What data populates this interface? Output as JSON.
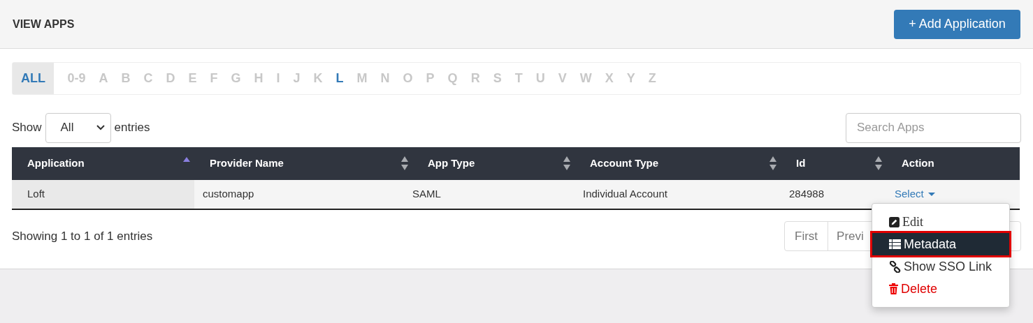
{
  "header": {
    "title": "VIEW APPS",
    "add_button": "+ Add Application"
  },
  "letters": [
    {
      "label": "ALL",
      "selected": true,
      "enabled": true
    },
    {
      "label": "0-9",
      "selected": false,
      "enabled": false
    },
    {
      "label": "A",
      "selected": false,
      "enabled": false
    },
    {
      "label": "B",
      "selected": false,
      "enabled": false
    },
    {
      "label": "C",
      "selected": false,
      "enabled": false
    },
    {
      "label": "D",
      "selected": false,
      "enabled": false
    },
    {
      "label": "E",
      "selected": false,
      "enabled": false
    },
    {
      "label": "F",
      "selected": false,
      "enabled": false
    },
    {
      "label": "G",
      "selected": false,
      "enabled": false
    },
    {
      "label": "H",
      "selected": false,
      "enabled": false
    },
    {
      "label": "I",
      "selected": false,
      "enabled": false
    },
    {
      "label": "J",
      "selected": false,
      "enabled": false
    },
    {
      "label": "K",
      "selected": false,
      "enabled": false
    },
    {
      "label": "L",
      "selected": false,
      "enabled": true
    },
    {
      "label": "M",
      "selected": false,
      "enabled": false
    },
    {
      "label": "N",
      "selected": false,
      "enabled": false
    },
    {
      "label": "O",
      "selected": false,
      "enabled": false
    },
    {
      "label": "P",
      "selected": false,
      "enabled": false
    },
    {
      "label": "Q",
      "selected": false,
      "enabled": false
    },
    {
      "label": "R",
      "selected": false,
      "enabled": false
    },
    {
      "label": "S",
      "selected": false,
      "enabled": false
    },
    {
      "label": "T",
      "selected": false,
      "enabled": false
    },
    {
      "label": "U",
      "selected": false,
      "enabled": false
    },
    {
      "label": "V",
      "selected": false,
      "enabled": false
    },
    {
      "label": "W",
      "selected": false,
      "enabled": false
    },
    {
      "label": "X",
      "selected": false,
      "enabled": false
    },
    {
      "label": "Y",
      "selected": false,
      "enabled": false
    },
    {
      "label": "Z",
      "selected": false,
      "enabled": false
    }
  ],
  "length": {
    "before": "Show",
    "value": "All",
    "after": "entries"
  },
  "search": {
    "placeholder": "Search Apps"
  },
  "table": {
    "columns": [
      {
        "label": "Application",
        "sortable": true,
        "sorted": true
      },
      {
        "label": "Provider Name",
        "sortable": true,
        "sorted": false
      },
      {
        "label": "App Type",
        "sortable": true,
        "sorted": false
      },
      {
        "label": "Account Type",
        "sortable": true,
        "sorted": false
      },
      {
        "label": "Id",
        "sortable": true,
        "sorted": false
      },
      {
        "label": "Action",
        "sortable": false
      }
    ],
    "rows": [
      {
        "cells": [
          "Loft",
          "customapp",
          "SAML",
          "Individual Account",
          "284988"
        ],
        "action": "Select"
      }
    ]
  },
  "info": "Showing 1 to 1 of 1 entries",
  "pagination": [
    "First",
    "Previ"
  ],
  "menu": [
    {
      "kind": "edit",
      "label": "Edit",
      "selected": false
    },
    {
      "kind": "metadata",
      "label": "Metadata",
      "selected": true
    },
    {
      "kind": "link",
      "label": "Show SSO Link",
      "selected": false
    },
    {
      "kind": "delete",
      "label": "Delete",
      "selected": false
    }
  ]
}
